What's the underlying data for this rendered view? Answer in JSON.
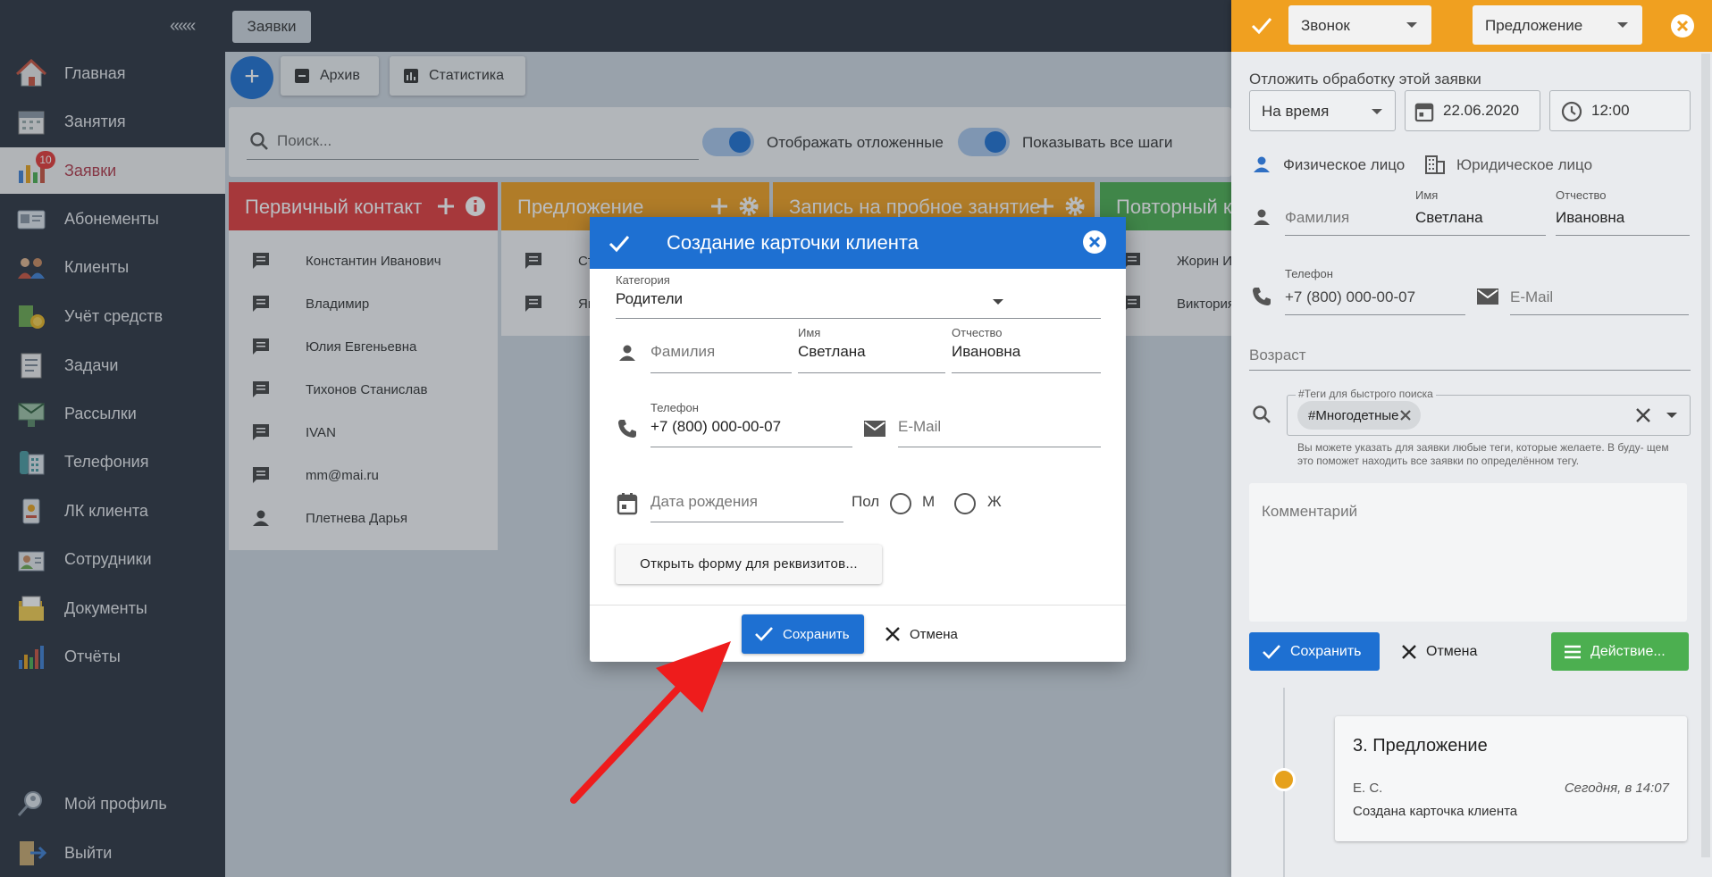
{
  "sidebar": {
    "collapse": "«««",
    "items": [
      {
        "label": "Главная",
        "icon": "home-icon"
      },
      {
        "label": "Занятия",
        "icon": "calendar-icon"
      },
      {
        "label": "Заявки",
        "icon": "requests-chart-icon",
        "badge": "10",
        "active": true
      },
      {
        "label": "Абонементы",
        "icon": "subscription-card-icon"
      },
      {
        "label": "Клиенты",
        "icon": "clients-icon"
      },
      {
        "label": "Учёт средств",
        "icon": "money-icon"
      },
      {
        "label": "Задачи",
        "icon": "tasks-icon"
      },
      {
        "label": "Рассылки",
        "icon": "mailing-icon"
      },
      {
        "label": "Телефония",
        "icon": "phone-station-icon"
      },
      {
        "label": "ЛК клиента",
        "icon": "client-account-icon"
      },
      {
        "label": "Сотрудники",
        "icon": "staff-icon"
      },
      {
        "label": "Документы",
        "icon": "documents-icon"
      },
      {
        "label": "Отчёты",
        "icon": "reports-icon"
      }
    ],
    "profile": "Мой профиль",
    "logout": "Выйти"
  },
  "topbar": {
    "tab": "Заявки"
  },
  "toolbar": {
    "archive": "Архив",
    "stats": "Статистика",
    "add": "+"
  },
  "filters": {
    "search_placeholder": "Поиск...",
    "toggle1": "Отображать отложенные",
    "toggle2": "Показывать все шаги"
  },
  "columns": [
    {
      "title": "Первичный контакт",
      "color": "#e23c3c",
      "rows": [
        "Константин Иванович",
        "Владимир",
        "Юлия Евгеньевна",
        "Тихонов Станислав",
        "IVAN",
        "mm@mai.ru",
        "Плетнева Дарья"
      ]
    },
    {
      "title": "Предложение",
      "color": "#f0a020",
      "rows": [
        "Ст",
        "Як"
      ]
    },
    {
      "title": "Запись на пробное занятие",
      "color": "#f0a020",
      "rows": []
    },
    {
      "title": "Повторный ко",
      "color": "#4caf50",
      "rows": [
        "Жорин Иг",
        "Виктория"
      ]
    }
  ],
  "modal": {
    "title": "Создание карточки клиента",
    "category_label": "Категория",
    "category_value": "Родители",
    "lastname_ph": "Фамилия",
    "firstname_label": "Имя",
    "firstname_value": "Светлана",
    "middlename_label": "Отчество",
    "middlename_value": "Ивановна",
    "phone_label": "Телефон",
    "phone_value": "+7 (800) 000-00-07",
    "email_ph": "E-Mail",
    "birth_ph": "Дата рождения",
    "gender_label": "Пол",
    "gender_m": "М",
    "gender_f": "Ж",
    "req_button": "Открыть форму для реквизитов...",
    "save": "Сохранить",
    "cancel": "Отмена"
  },
  "right_panel": {
    "type_select": "Звонок",
    "stage_select": "Предложение",
    "postpone_label": "Отложить обработку этой заявки",
    "postpone_mode": "На время",
    "date": "22.06.2020",
    "time": "12:00",
    "person_physical": "Физическое лицо",
    "person_legal": "Юридическое лицо",
    "lastname_ph": "Фамилия",
    "firstname_label": "Имя",
    "firstname_value": "Светлана",
    "middlename_label": "Отчество",
    "middlename_value": "Ивановна",
    "phone_label": "Телефон",
    "phone_value": "+7 (800) 000-00-07",
    "email_ph": "E-Mail",
    "age_ph": "Возраст",
    "tags_label": "#Теги для быстрого поиска",
    "tag": "#Многодетные",
    "tags_hint": "Вы можете указать для заявки любые теги, которые желаете. В буду- щем это поможет находить все заявки по определённом тегу.",
    "comment_ph": "Комментарий",
    "save": "Сохранить",
    "cancel": "Отмена",
    "action": "Действие...",
    "history_title": "3. Предложение",
    "history_author": "Е. С.",
    "history_time": "Сегодня, в 14:07",
    "history_text": "Создана карточка клиента"
  }
}
